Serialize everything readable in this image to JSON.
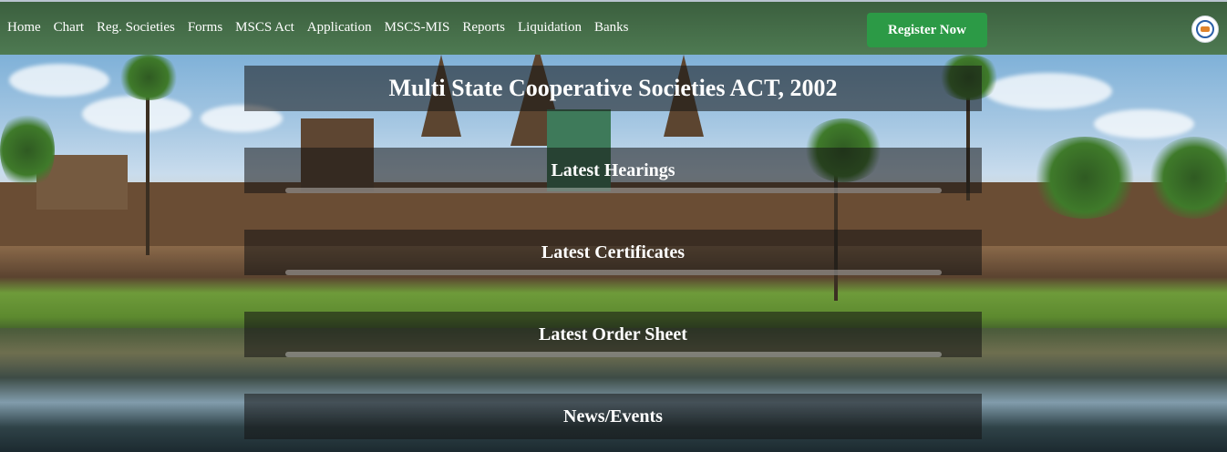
{
  "navbar": {
    "links": [
      "Home",
      "Chart",
      "Reg. Societies",
      "Forms",
      "MSCS Act",
      "Application",
      "MSCS-MIS",
      "Reports",
      "Liquidation",
      "Banks"
    ],
    "register_label": "Register Now",
    "logo_icon": "emblem-logo"
  },
  "main": {
    "title": "Multi State Cooperative Societies ACT, 2002",
    "sections": [
      {
        "title": "Latest Hearings"
      },
      {
        "title": "Latest Certificates"
      },
      {
        "title": "Latest Order Sheet"
      },
      {
        "title": "News/Events"
      }
    ]
  },
  "colors": {
    "navbar": "#4e7a52",
    "register_button": "#2c9a46",
    "panel_overlay": "rgba(20,20,20,0.55)"
  }
}
